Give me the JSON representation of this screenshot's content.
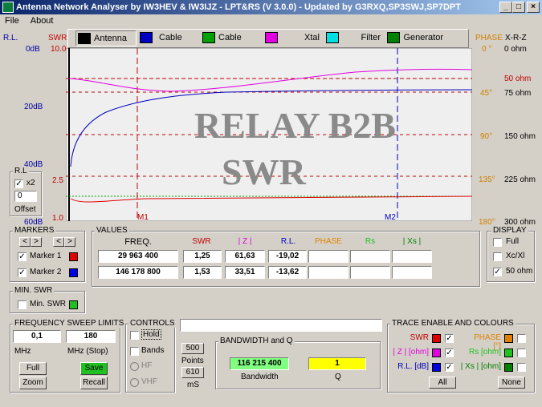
{
  "window": {
    "title": "Antenna Network Analyser by IW3HEV & IW3IJZ - LPT&RS (V 3.0.0) - Updated by G3RXQ,SP3SWJ,SP7DPT",
    "min": "_",
    "max": "□",
    "close": "×"
  },
  "menu": [
    "File",
    "About"
  ],
  "tabs": [
    {
      "label": "Antenna",
      "color": "#000000"
    },
    {
      "label": "Cable Loss",
      "color": "#0000c0"
    },
    {
      "label": "Cable Length",
      "color": "#00a000"
    },
    {
      "label": "Xtal",
      "color": "#e000e0"
    },
    {
      "label": "Filter",
      "color": "#00e0e0"
    },
    {
      "label": "Generator",
      "color": "#008000"
    }
  ],
  "axes": {
    "rl_header": "R.L.",
    "swr_header": "SWR",
    "phase_header": "PHASE",
    "xrz_header": "X-R-Z",
    "rl_ticks": [
      "0dB",
      "20dB",
      "40dB",
      "60dB"
    ],
    "swr_ticks": [
      "10.0",
      "2.5",
      "1.0"
    ],
    "phase_ticks": [
      "0 °",
      "45°",
      "90°",
      "135°",
      "180°"
    ],
    "ohm_ticks": [
      "0 ohm",
      "75 ohm",
      "150 ohm",
      "225 ohm",
      "300 ohm"
    ],
    "ref_label": "50 ohm"
  },
  "graph": {
    "watermark_line1": "RELAY B2B",
    "watermark_line2": "SWR",
    "marker1_label": "M1",
    "marker2_label": "M2"
  },
  "rl_box": {
    "title": "R.L",
    "x2_label": "x2",
    "x2_checked": "✓",
    "offset_value": "0",
    "offset_label": "Offset"
  },
  "markers": {
    "title": "MARKERS",
    "m1_label": "Marker 1",
    "m2_label": "Marker 2",
    "checked": "✓",
    "left": "<",
    "right": ">",
    "m1_color": "#e00000",
    "m2_color": "#0000e0"
  },
  "min_swr": {
    "title": "MIN. SWR",
    "label": "Min. SWR",
    "color": "#20c020"
  },
  "values": {
    "title": "VALUES",
    "headers": {
      "freq": "FREQ.",
      "swr": "SWR",
      "z": "| Z |",
      "rl": "R.L.",
      "phase": "PHASE",
      "rs": "Rs",
      "xs": "| Xs |"
    },
    "rows": [
      {
        "freq": "29 963 400",
        "swr": "1,25",
        "z": "61,63",
        "rl": "-19,02",
        "phase": "",
        "rs": "",
        "xs": ""
      },
      {
        "freq": "146 178 800",
        "swr": "1,53",
        "z": "33,51",
        "rl": "-13,62",
        "phase": "",
        "rs": "",
        "xs": ""
      }
    ]
  },
  "display": {
    "title": "DISPLAY",
    "full": "Full",
    "xcxl": "Xc/Xl",
    "ohm50": "50 ohm",
    "checked": "✓"
  },
  "sweep": {
    "title": "FREQUENCY SWEEP LIMITS",
    "start": "0,1",
    "stop": "180",
    "unit_start": "MHz",
    "unit_stop": "MHz  (Stop)",
    "full": "Full",
    "save": "Save",
    "zoom": "Zoom",
    "recall": "Recall"
  },
  "controls": {
    "title": "CONTROLS",
    "hold": "Hold",
    "bands": "Bands",
    "hf": "HF",
    "vhf": "VHF"
  },
  "points": {
    "value": "500",
    "label": "Points",
    "ms_value": "610",
    "ms_label": "mS"
  },
  "bandwidth": {
    "title": "BANDWIDTH and Q",
    "bw_value": "116 215 400",
    "bw_label": "Bandwidth",
    "q_value": "1",
    "q_label": "Q"
  },
  "trace": {
    "title": "TRACE ENABLE AND COLOURS",
    "swr": "SWR",
    "phase": "PHASE [°]",
    "z": "| Z | [ohm]",
    "rs": "Rs [ohm]",
    "rl": "R.L. [dB]",
    "xs": "| Xs | [ohm]",
    "all": "All",
    "none": "None",
    "checked": "✓",
    "colors": {
      "swr": "#e00000",
      "phase": "#e08000",
      "z": "#e000e0",
      "rs": "#20c020",
      "rl": "#0000e0",
      "xs": "#008000"
    }
  }
}
